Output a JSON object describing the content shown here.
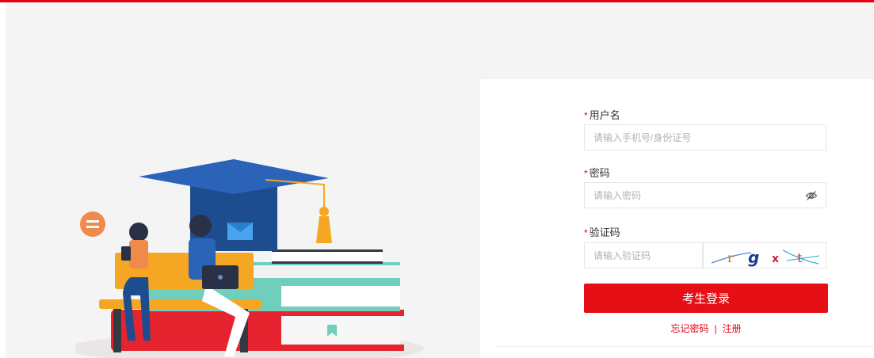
{
  "form": {
    "username": {
      "required_mark": "*",
      "label": "用户名",
      "placeholder": "请输入手机号/身份证号",
      "value": ""
    },
    "password": {
      "required_mark": "*",
      "label": "密码",
      "placeholder": "请输入密码",
      "value": "",
      "toggle_icon": "eye-off-icon"
    },
    "captcha": {
      "required_mark": "*",
      "label": "验证码",
      "placeholder": "请输入验证码",
      "value": "",
      "image_text": "rgxt"
    },
    "login_button": "考生登录",
    "forgot_password": "忘记密码",
    "separator": "|",
    "register": "注册"
  },
  "colors": {
    "accent": "#e60012",
    "page_background": "#f4f4f4",
    "panel_background": "#ffffff"
  }
}
